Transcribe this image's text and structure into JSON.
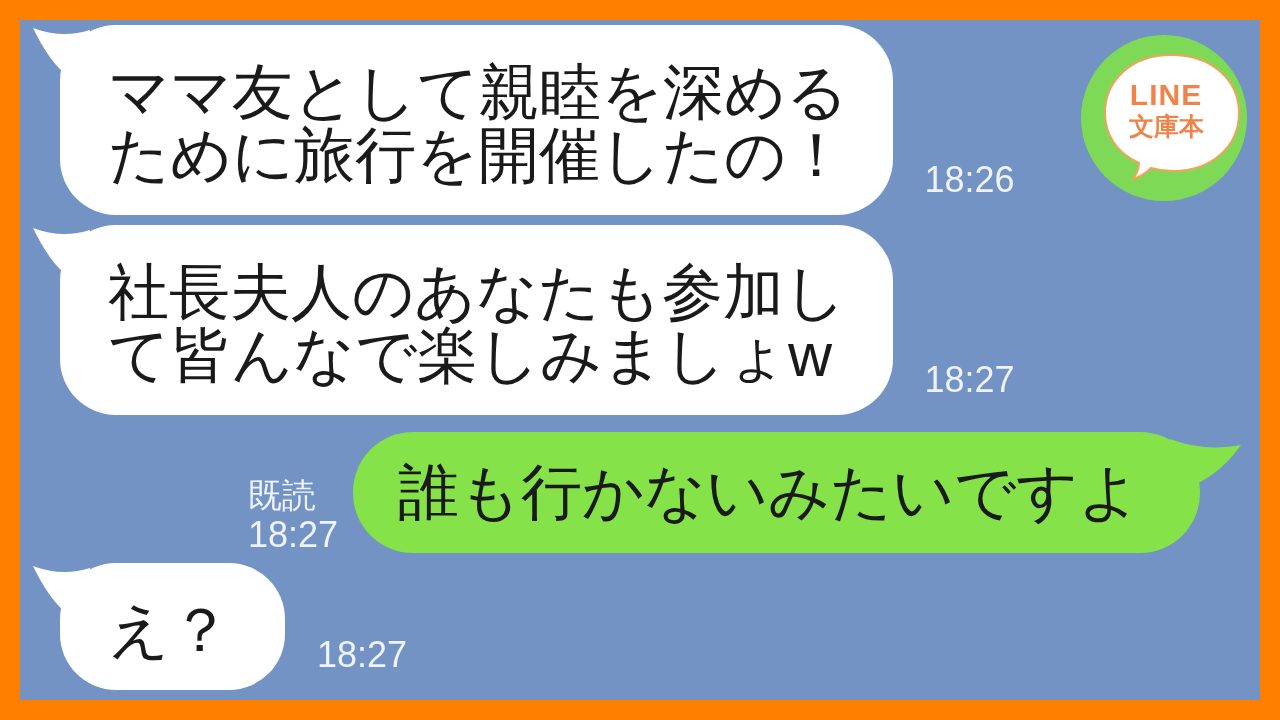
{
  "logo": {
    "title": "LINE",
    "subtitle": "文庫本"
  },
  "messages": [
    {
      "kind": "incoming",
      "text": "ママ友として親睦を深めるために旅行を開催したの！",
      "time": "18:26"
    },
    {
      "kind": "incoming",
      "text": "社長夫人のあなたも参加して皆んなで楽しみましょw",
      "time": "18:27"
    },
    {
      "kind": "outgoing",
      "text": "誰も行かないみたいですよ",
      "read_label": "既読",
      "time": "18:27"
    },
    {
      "kind": "incoming",
      "text": "え？",
      "time": "18:27"
    }
  ]
}
